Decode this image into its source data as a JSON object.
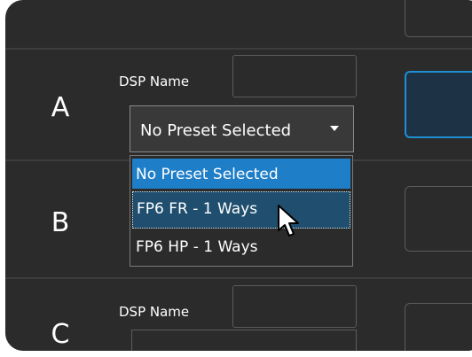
{
  "rows": [
    {
      "letter": "A",
      "dsp_label": "DSP Name"
    },
    {
      "letter": "B"
    },
    {
      "letter": "C",
      "dsp_label": "DSP Name"
    }
  ],
  "preset_select": {
    "value": "No Preset Selected",
    "options": [
      "No Preset Selected",
      "FP6 FR - 1 Ways",
      "FP6 HP - 1 Ways"
    ],
    "selected_index": 0,
    "hovered_index": 1
  },
  "colors": {
    "panel": "#2b2b2b",
    "accent": "#1e7ec8",
    "hover": "#1f4e6e",
    "active_border": "#1e8fd2"
  }
}
